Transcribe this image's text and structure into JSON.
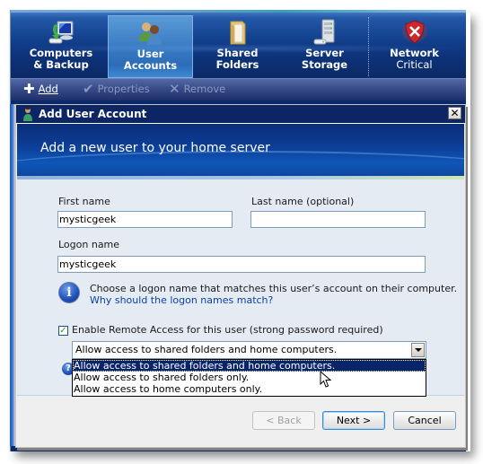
{
  "topnav": {
    "tabs": [
      {
        "label": "Computers",
        "label2": "& Backup",
        "icon": "computer-backup-icon",
        "active": false
      },
      {
        "label": "User",
        "label2": "Accounts",
        "icon": "users-icon",
        "active": true
      },
      {
        "label": "Shared",
        "label2": "Folders",
        "icon": "folder-icon",
        "active": false
      },
      {
        "label": "Server",
        "label2": "Storage",
        "icon": "server-icon",
        "active": false
      },
      {
        "label": "Network",
        "label2": "Critical",
        "icon": "shield-error-icon",
        "active": false
      }
    ]
  },
  "toolbar": {
    "add_label": "Add",
    "properties_label": "Properties",
    "remove_label": "Remove"
  },
  "dialog": {
    "title": "Add User Account",
    "close_glyph": "✕",
    "banner_title": "Add a new user to your home server",
    "first_name_label": "First name",
    "first_name_value": "mysticgeek",
    "last_name_label": "Last name (optional)",
    "last_name_value": "",
    "logon_name_label": "Logon name",
    "logon_name_value": "mysticgeek",
    "info_text": "Choose a logon name that matches this user’s account on their computer.",
    "info_link": "Why should the logon names match?",
    "remote_access_checked": true,
    "remote_access_label": "Enable Remote Access for this user (strong password required)",
    "access_select_value": "Allow access to shared folders and home computers.",
    "access_options": [
      "Allow access to shared folders and home computers.",
      "Allow access to shared folders only.",
      "Allow access to home computers only."
    ],
    "buttons": {
      "back": "< Back",
      "next": "Next >",
      "cancel": "Cancel"
    }
  },
  "colors": {
    "nav_bg": "#0d3278",
    "title_bar": "#0c2565",
    "selection": "#0a246a",
    "content_bg": "#e4ebf3",
    "link": "#0b3fa6",
    "critical": "#c8282e"
  }
}
